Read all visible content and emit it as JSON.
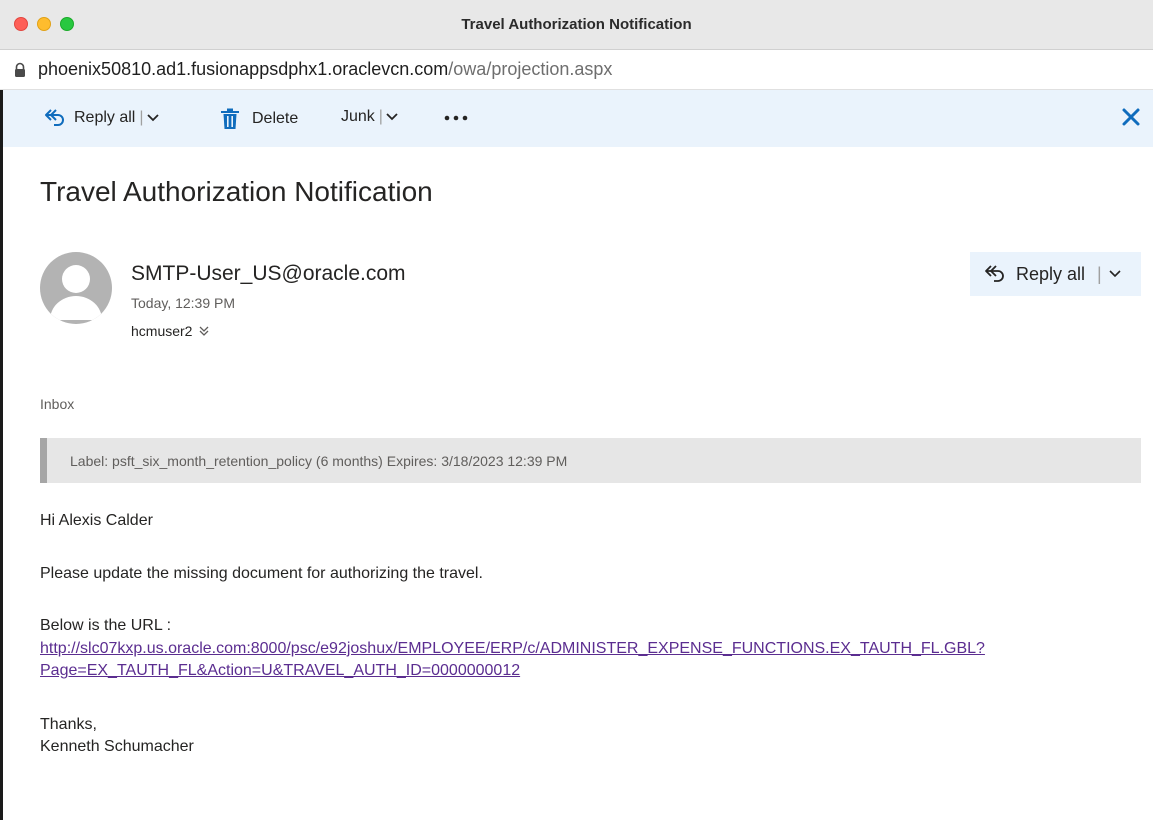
{
  "window": {
    "title": "Travel Authorization Notification"
  },
  "address_bar": {
    "host": "phoenix50810.ad1.fusionappsdphx1.oraclevcn.com",
    "path": "/owa/projection.aspx"
  },
  "toolbar": {
    "reply_all_label": "Reply all",
    "delete_label": "Delete",
    "junk_label": "Junk"
  },
  "message": {
    "subject": "Travel Authorization Notification",
    "sender": "SMTP-User_US@oracle.com",
    "date": "Today, 12:39 PM",
    "recipient": "hcmuser2",
    "reply_all_label": "Reply all",
    "folder": "Inbox",
    "retention_label": "Label: psft_six_month_retention_policy (6 months) Expires: 3/18/2023 12:39 PM",
    "body": {
      "greeting": "Hi Alexis Calder",
      "paragraph": "Please update the missing document for authorizing the travel.",
      "url_intro": "Below is the URL :",
      "url_line1": "http://slc07kxp.us.oracle.com:8000/psc/e92joshux/EMPLOYEE/ERP/c/ADMINISTER_EXPENSE_FUNCTIONS.EX_TAUTH_FL.GBL?",
      "url_line2": "Page=EX_TAUTH_FL&Action=U&TRAVEL_AUTH_ID=0000000012",
      "closing": "Thanks,",
      "signature": "Kenneth Schumacher"
    }
  },
  "colors": {
    "accent": "#0f6cbd",
    "command_bar_bg": "#eaf3fc",
    "link": "#5b2d90"
  }
}
